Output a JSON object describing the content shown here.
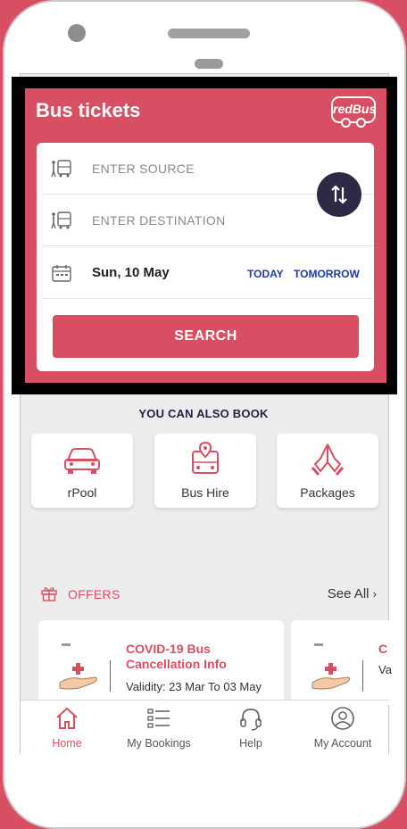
{
  "header": {
    "title": "Bus tickets",
    "logo": "redBus"
  },
  "form": {
    "source_placeholder": "ENTER SOURCE",
    "destination_placeholder": "ENTER DESTINATION",
    "date": "Sun, 10 May",
    "today": "TODAY",
    "tomorrow": "TOMORROW",
    "search": "SEARCH"
  },
  "also_book": {
    "title": "YOU CAN ALSO BOOK",
    "tiles": [
      {
        "label": "rPool",
        "icon": "car-icon"
      },
      {
        "label": "Bus Hire",
        "icon": "bus-hire-icon"
      },
      {
        "label": "Packages",
        "icon": "folded-hands-icon"
      }
    ]
  },
  "offers": {
    "title": "OFFERS",
    "see_all": "See All",
    "items": [
      {
        "title_line1": "COVID-19 Bus",
        "title_line2": "Cancellation Info",
        "validity": "Validity: 23 Mar To 03 May"
      },
      {
        "title_line1": "C",
        "title_line2": "",
        "validity": "Va"
      }
    ]
  },
  "bottom_nav": [
    {
      "label": "Home",
      "icon": "home-icon",
      "active": true
    },
    {
      "label": "My Bookings",
      "icon": "list-icon",
      "active": false
    },
    {
      "label": "Help",
      "icon": "headset-icon",
      "active": false
    },
    {
      "label": "My Account",
      "icon": "account-icon",
      "active": false
    }
  ],
  "colors": {
    "brand": "#d84e63",
    "nav_text": "#1d3ba8",
    "swap_bg": "#2e2a46"
  }
}
